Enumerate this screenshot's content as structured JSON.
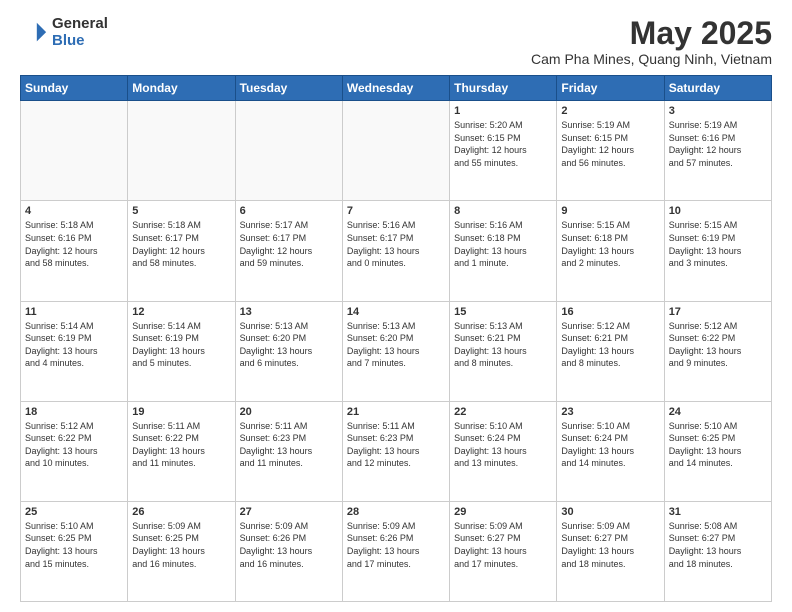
{
  "logo": {
    "general": "General",
    "blue": "Blue"
  },
  "title": "May 2025",
  "subtitle": "Cam Pha Mines, Quang Ninh, Vietnam",
  "headers": [
    "Sunday",
    "Monday",
    "Tuesday",
    "Wednesday",
    "Thursday",
    "Friday",
    "Saturday"
  ],
  "weeks": [
    [
      {
        "day": "",
        "info": ""
      },
      {
        "day": "",
        "info": ""
      },
      {
        "day": "",
        "info": ""
      },
      {
        "day": "",
        "info": ""
      },
      {
        "day": "1",
        "info": "Sunrise: 5:20 AM\nSunset: 6:15 PM\nDaylight: 12 hours\nand 55 minutes."
      },
      {
        "day": "2",
        "info": "Sunrise: 5:19 AM\nSunset: 6:15 PM\nDaylight: 12 hours\nand 56 minutes."
      },
      {
        "day": "3",
        "info": "Sunrise: 5:19 AM\nSunset: 6:16 PM\nDaylight: 12 hours\nand 57 minutes."
      }
    ],
    [
      {
        "day": "4",
        "info": "Sunrise: 5:18 AM\nSunset: 6:16 PM\nDaylight: 12 hours\nand 58 minutes."
      },
      {
        "day": "5",
        "info": "Sunrise: 5:18 AM\nSunset: 6:17 PM\nDaylight: 12 hours\nand 58 minutes."
      },
      {
        "day": "6",
        "info": "Sunrise: 5:17 AM\nSunset: 6:17 PM\nDaylight: 12 hours\nand 59 minutes."
      },
      {
        "day": "7",
        "info": "Sunrise: 5:16 AM\nSunset: 6:17 PM\nDaylight: 13 hours\nand 0 minutes."
      },
      {
        "day": "8",
        "info": "Sunrise: 5:16 AM\nSunset: 6:18 PM\nDaylight: 13 hours\nand 1 minute."
      },
      {
        "day": "9",
        "info": "Sunrise: 5:15 AM\nSunset: 6:18 PM\nDaylight: 13 hours\nand 2 minutes."
      },
      {
        "day": "10",
        "info": "Sunrise: 5:15 AM\nSunset: 6:19 PM\nDaylight: 13 hours\nand 3 minutes."
      }
    ],
    [
      {
        "day": "11",
        "info": "Sunrise: 5:14 AM\nSunset: 6:19 PM\nDaylight: 13 hours\nand 4 minutes."
      },
      {
        "day": "12",
        "info": "Sunrise: 5:14 AM\nSunset: 6:19 PM\nDaylight: 13 hours\nand 5 minutes."
      },
      {
        "day": "13",
        "info": "Sunrise: 5:13 AM\nSunset: 6:20 PM\nDaylight: 13 hours\nand 6 minutes."
      },
      {
        "day": "14",
        "info": "Sunrise: 5:13 AM\nSunset: 6:20 PM\nDaylight: 13 hours\nand 7 minutes."
      },
      {
        "day": "15",
        "info": "Sunrise: 5:13 AM\nSunset: 6:21 PM\nDaylight: 13 hours\nand 8 minutes."
      },
      {
        "day": "16",
        "info": "Sunrise: 5:12 AM\nSunset: 6:21 PM\nDaylight: 13 hours\nand 8 minutes."
      },
      {
        "day": "17",
        "info": "Sunrise: 5:12 AM\nSunset: 6:22 PM\nDaylight: 13 hours\nand 9 minutes."
      }
    ],
    [
      {
        "day": "18",
        "info": "Sunrise: 5:12 AM\nSunset: 6:22 PM\nDaylight: 13 hours\nand 10 minutes."
      },
      {
        "day": "19",
        "info": "Sunrise: 5:11 AM\nSunset: 6:22 PM\nDaylight: 13 hours\nand 11 minutes."
      },
      {
        "day": "20",
        "info": "Sunrise: 5:11 AM\nSunset: 6:23 PM\nDaylight: 13 hours\nand 11 minutes."
      },
      {
        "day": "21",
        "info": "Sunrise: 5:11 AM\nSunset: 6:23 PM\nDaylight: 13 hours\nand 12 minutes."
      },
      {
        "day": "22",
        "info": "Sunrise: 5:10 AM\nSunset: 6:24 PM\nDaylight: 13 hours\nand 13 minutes."
      },
      {
        "day": "23",
        "info": "Sunrise: 5:10 AM\nSunset: 6:24 PM\nDaylight: 13 hours\nand 14 minutes."
      },
      {
        "day": "24",
        "info": "Sunrise: 5:10 AM\nSunset: 6:25 PM\nDaylight: 13 hours\nand 14 minutes."
      }
    ],
    [
      {
        "day": "25",
        "info": "Sunrise: 5:10 AM\nSunset: 6:25 PM\nDaylight: 13 hours\nand 15 minutes."
      },
      {
        "day": "26",
        "info": "Sunrise: 5:09 AM\nSunset: 6:25 PM\nDaylight: 13 hours\nand 16 minutes."
      },
      {
        "day": "27",
        "info": "Sunrise: 5:09 AM\nSunset: 6:26 PM\nDaylight: 13 hours\nand 16 minutes."
      },
      {
        "day": "28",
        "info": "Sunrise: 5:09 AM\nSunset: 6:26 PM\nDaylight: 13 hours\nand 17 minutes."
      },
      {
        "day": "29",
        "info": "Sunrise: 5:09 AM\nSunset: 6:27 PM\nDaylight: 13 hours\nand 17 minutes."
      },
      {
        "day": "30",
        "info": "Sunrise: 5:09 AM\nSunset: 6:27 PM\nDaylight: 13 hours\nand 18 minutes."
      },
      {
        "day": "31",
        "info": "Sunrise: 5:08 AM\nSunset: 6:27 PM\nDaylight: 13 hours\nand 18 minutes."
      }
    ]
  ]
}
